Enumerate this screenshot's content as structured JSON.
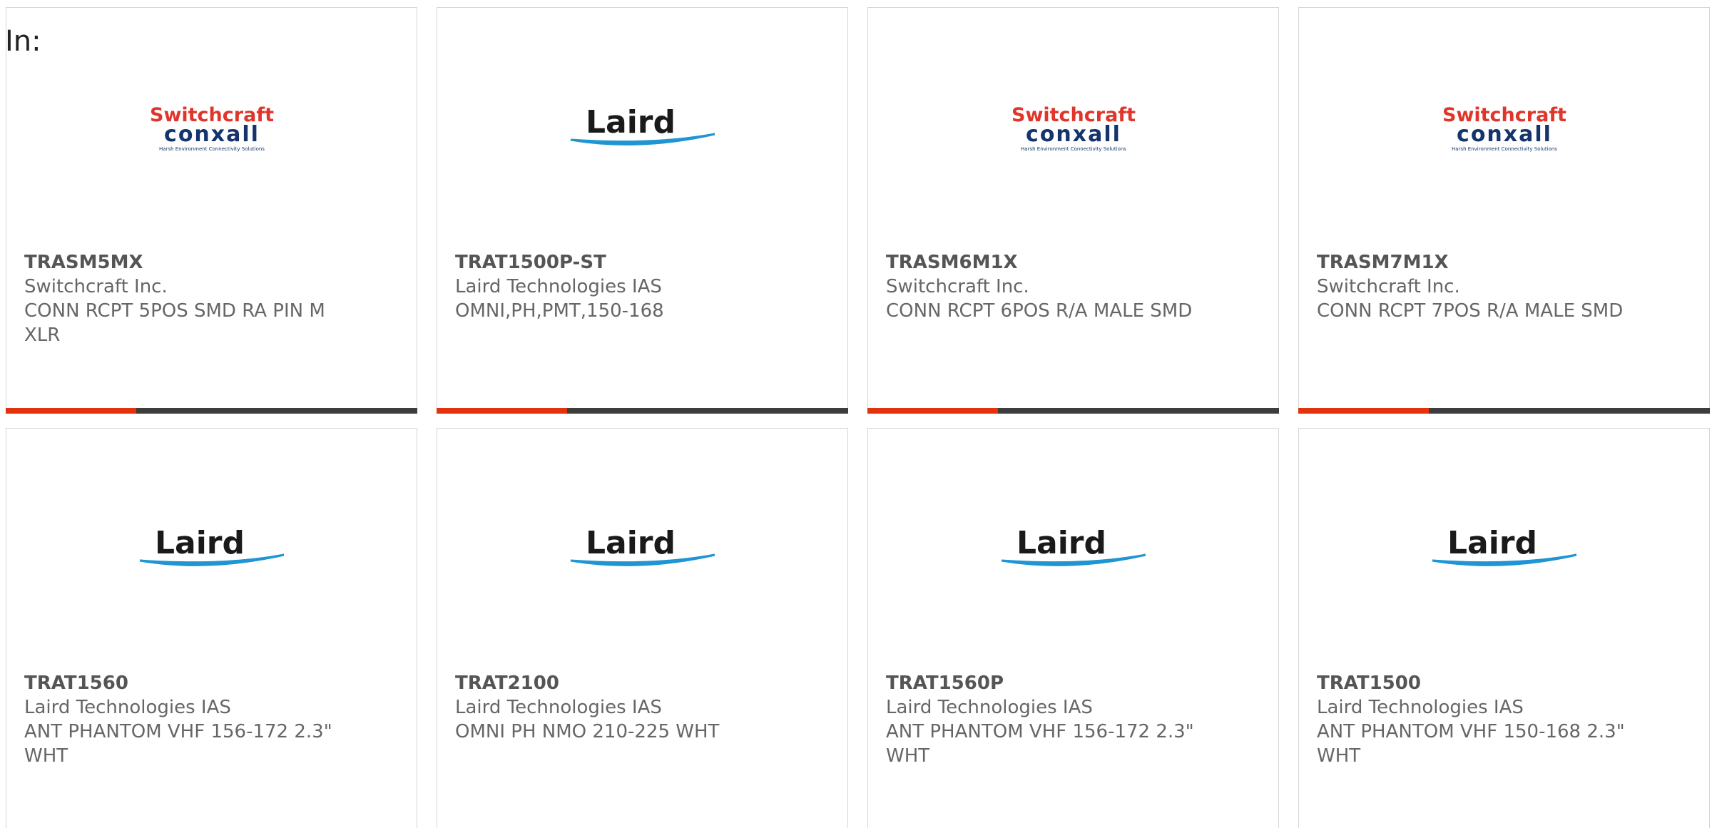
{
  "filter": {
    "label": "In:"
  },
  "colors": {
    "accent": "#e3330c",
    "bar": "#3d3d3d",
    "switchcraft_red": "#e0352b",
    "conxall_navy": "#14346b",
    "laird_blue": "#1f95d3"
  },
  "logos": {
    "switchcraft": {
      "line1": "Switchcraft",
      "line2": "conxall",
      "tagline": "Harsh Environment Connectivity Solutions"
    },
    "laird": {
      "text": "Laird"
    }
  },
  "products": [
    {
      "part_number": "TRASM5MX",
      "manufacturer": "Switchcraft Inc.",
      "description": "CONN RCPT 5POS SMD RA PIN M XLR",
      "logo": "switchcraft"
    },
    {
      "part_number": "TRAT1500P-ST",
      "manufacturer": "Laird Technologies IAS",
      "description": "OMNI,PH,PMT,150-168",
      "logo": "laird"
    },
    {
      "part_number": "TRASM6M1X",
      "manufacturer": "Switchcraft Inc.",
      "description": "CONN RCPT 6POS R/A MALE SMD",
      "logo": "switchcraft"
    },
    {
      "part_number": "TRASM7M1X",
      "manufacturer": "Switchcraft Inc.",
      "description": "CONN RCPT 7POS R/A MALE SMD",
      "logo": "switchcraft"
    },
    {
      "part_number": "TRAT1560",
      "manufacturer": "Laird Technologies IAS",
      "description": "ANT PHANTOM VHF 156-172 2.3\" WHT",
      "logo": "laird"
    },
    {
      "part_number": "TRAT2100",
      "manufacturer": "Laird Technologies IAS",
      "description": "OMNI PH NMO 210-225 WHT",
      "logo": "laird"
    },
    {
      "part_number": "TRAT1560P",
      "manufacturer": "Laird Technologies IAS",
      "description": "ANT PHANTOM VHF 156-172 2.3\" WHT",
      "logo": "laird"
    },
    {
      "part_number": "TRAT1500",
      "manufacturer": "Laird Technologies IAS",
      "description": "ANT PHANTOM VHF 150-168 2.3\" WHT",
      "logo": "laird"
    }
  ]
}
